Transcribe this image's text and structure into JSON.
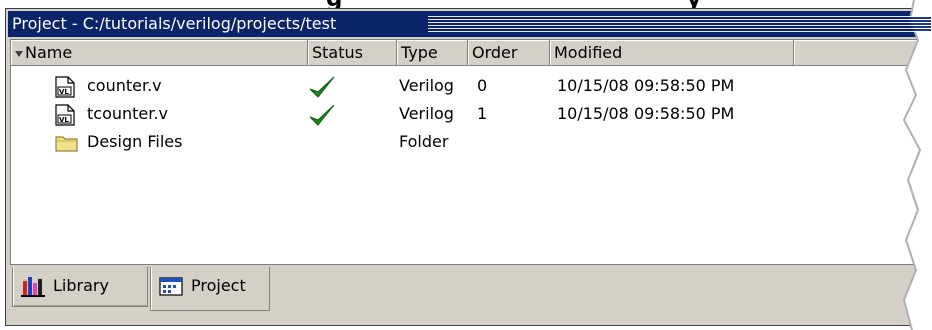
{
  "window": {
    "title": "Project - C:/tutorials/verilog/projects/test",
    "clipped_heading": [
      "g",
      "y"
    ]
  },
  "columns": [
    "Name",
    "Status",
    "Type",
    "Order",
    "Modified"
  ],
  "rows": [
    {
      "name": "counter.v",
      "icon": "verilog-file-icon",
      "status": "checkmark-icon",
      "type": "Verilog",
      "order": "0",
      "modified": "10/15/08 09:58:50 PM"
    },
    {
      "name": "tcounter.v",
      "icon": "verilog-file-icon",
      "status": "checkmark-icon",
      "type": "Verilog",
      "order": "1",
      "modified": "10/15/08 09:58:50 PM"
    },
    {
      "name": "Design Files",
      "icon": "folder-icon",
      "status": "",
      "type": "Folder",
      "order": "",
      "modified": ""
    }
  ],
  "tabs": [
    {
      "label": "Library",
      "icon": "library-icon",
      "active": false
    },
    {
      "label": "Project",
      "icon": "project-icon",
      "active": true
    }
  ],
  "colors": {
    "titlebar": "#0a246a",
    "panel": "#d4d0c8",
    "check": "#1a8a1a"
  }
}
